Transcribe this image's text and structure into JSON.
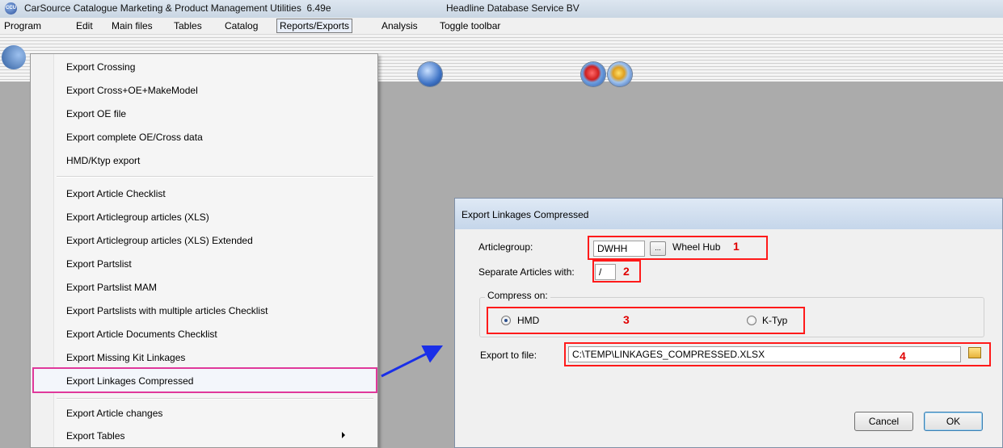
{
  "window": {
    "title": "CarSource Catalogue Marketing & Product Management Utilities  6.49e",
    "company": "Headline Database Service BV"
  },
  "menubar": {
    "items": [
      "Program",
      "Edit",
      "Main files",
      "Tables",
      "Catalog",
      "Reports/Exports",
      "Analysis",
      "Toggle toolbar"
    ],
    "active": "Reports/Exports"
  },
  "dropdown": {
    "items": [
      "Export Crossing",
      "Export Cross+OE+MakeModel",
      "Export OE file",
      "Export complete OE/Cross data",
      "HMD/Ktyp export",
      "Export Article Checklist",
      "Export Articlegroup articles (XLS)",
      "Export Articlegroup articles (XLS) Extended",
      "Export Partslist",
      "Export Partslist MAM",
      "Export Partslists with multiple articles Checklist",
      "Export Article Documents Checklist",
      "Export Missing Kit Linkages",
      "Export Linkages Compressed",
      "Export Article changes",
      "Export Tables"
    ],
    "highlighted": "Export Linkages Compressed"
  },
  "dialog": {
    "title": "Export Linkages Compressed",
    "articlegroup_label": "Articlegroup:",
    "articlegroup_value": "DWHH",
    "browse_label": "...",
    "articlegroup_name": "Wheel Hub",
    "separate_label": "Separate Articles with:",
    "separate_value": "/",
    "compress_label": "Compress on:",
    "radio_hmd": "HMD",
    "radio_ktyp": "K-Typ",
    "selected_radio": "HMD",
    "export_label": "Export to file:",
    "export_value": "C:\\TEMP\\LINKAGES_COMPRESSED.XLSX",
    "cancel_label": "Cancel",
    "ok_label": "OK"
  },
  "annotations": {
    "n1": "1",
    "n2": "2",
    "n3": "3",
    "n4": "4",
    "box_color": "#ff1a1a",
    "highlight_color": "#e0399b",
    "arrow_color": "#1a2fe8"
  },
  "icons": [
    "app-icon",
    "toolbar-globe-icon",
    "toolbar-refresh-icon",
    "toolbar-search-icon",
    "folder-icon",
    "submenu-arrow-icon"
  ]
}
